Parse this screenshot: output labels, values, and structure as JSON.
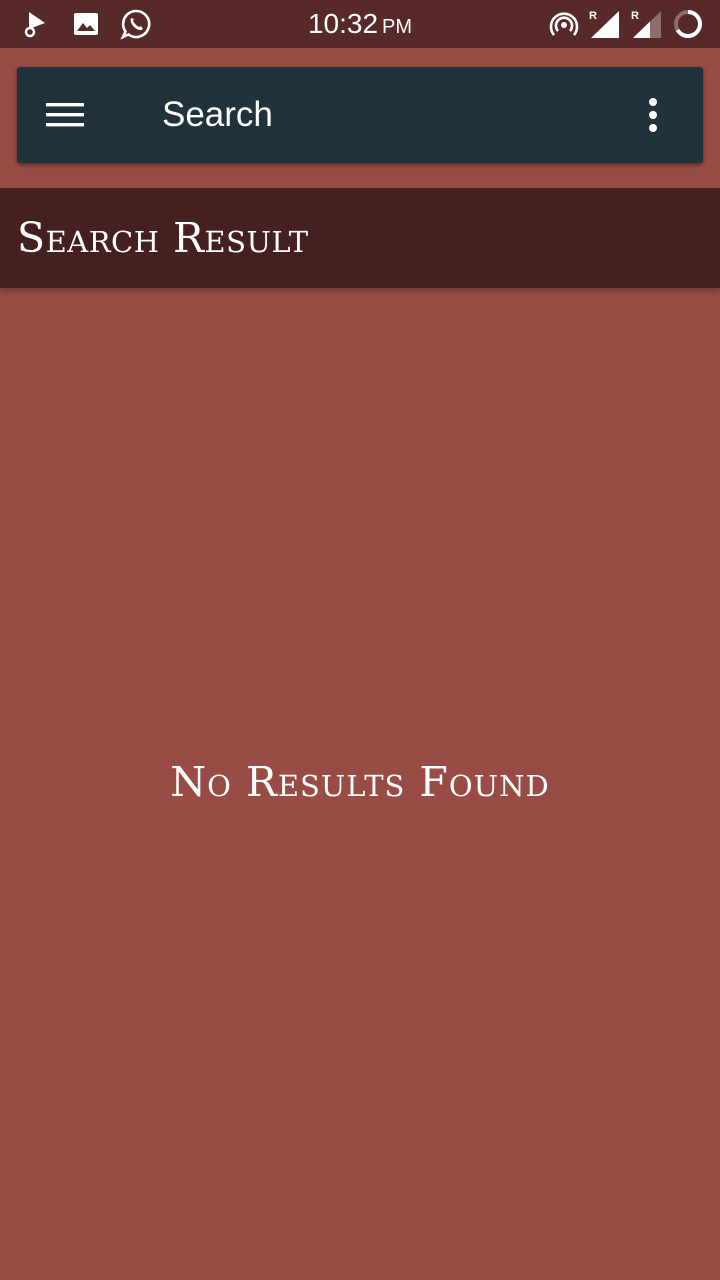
{
  "status_bar": {
    "time": "10:32",
    "ampm": "PM",
    "left_icons": [
      "music-app-icon",
      "gallery-icon",
      "whatsapp-icon"
    ],
    "right_icons": [
      "hotspot-icon",
      "signal-roaming-icon",
      "signal-roaming-2-icon",
      "battery-charging-icon"
    ],
    "roaming_label": "R"
  },
  "toolbar": {
    "title": "Search",
    "menu_icon": "hamburger-menu-icon",
    "overflow_icon": "more-vertical-icon"
  },
  "page": {
    "section_title": "Search Result",
    "empty_message": "No Results Found"
  },
  "colors": {
    "background": "#984c45",
    "status_bar": "#572a29",
    "toolbar": "#22323a",
    "header_band": "#452021",
    "text": "#ffffff"
  }
}
